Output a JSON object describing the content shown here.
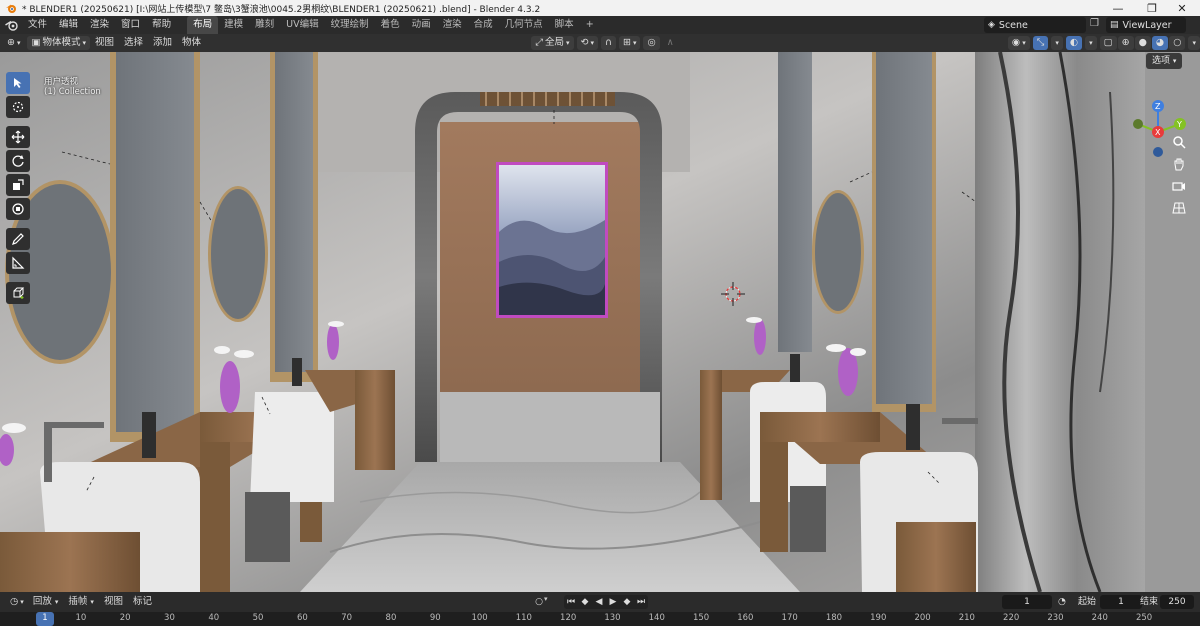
{
  "window": {
    "title": "* BLENDER1 (20250621)  [I:\\网站上传模型\\7 鳖岛\\3蟹浪池\\0045.2男桐纹\\BLENDER1 (20250621) .blend] - Blender 4.3.2",
    "controls": [
      "—",
      "❐",
      "✕"
    ]
  },
  "menu": [
    "文件",
    "编辑",
    "渲染",
    "窗口",
    "帮助"
  ],
  "workspaces": {
    "tabs": [
      "布局",
      "建模",
      "雕刻",
      "UV编辑",
      "纹理绘制",
      "着色",
      "动画",
      "渲染",
      "合成",
      "几何节点",
      "脚本"
    ],
    "active_index": 0,
    "add_label": "+"
  },
  "scene": {
    "name": "Scene"
  },
  "view_layer": {
    "name": "ViewLayer"
  },
  "viewport_header": {
    "mode": "物体模式",
    "menus": [
      "视图",
      "选择",
      "添加",
      "物体"
    ],
    "transform_orientation": "全局"
  },
  "viewport": {
    "view_name": "用户透视",
    "collection": "(1) Collection",
    "options_label": "选项",
    "gizmo_axes": [
      "Z",
      "X",
      "Y"
    ]
  },
  "timeline": {
    "menus": [
      "回放",
      "插帧",
      "视图",
      "标记"
    ],
    "current_frame": "1",
    "start_label": "起始",
    "start_value": "1",
    "end_label": "结束",
    "end_value": "250",
    "ruler_ticks": [
      "1",
      "10",
      "20",
      "30",
      "40",
      "50",
      "60",
      "70",
      "80",
      "90",
      "100",
      "110",
      "120",
      "130",
      "140",
      "150",
      "160",
      "170",
      "180",
      "190",
      "200",
      "210",
      "220",
      "230",
      "240",
      "250"
    ]
  },
  "colors": {
    "accent": "#4772b3",
    "header_bg": "#2b2b2b",
    "axis_x": "#e83b3b",
    "axis_y": "#84c224",
    "axis_z": "#3f7fe0"
  }
}
